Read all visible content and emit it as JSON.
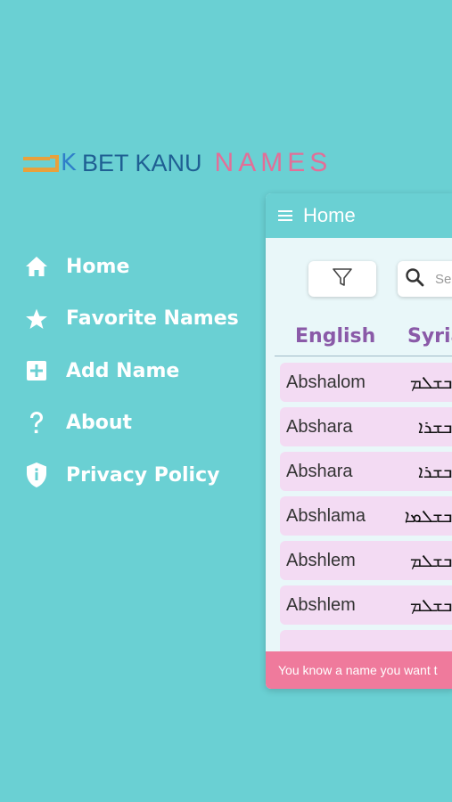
{
  "logo": {
    "text_primary": "BET KANU",
    "text_secondary": "NAMES",
    "mark_letter": "K"
  },
  "menu": {
    "items": [
      {
        "label": "Home",
        "icon": "home-icon"
      },
      {
        "label": "Favorite Names",
        "icon": "star-icon"
      },
      {
        "label": "Add Name",
        "icon": "add-box-icon"
      },
      {
        "label": "About",
        "icon": "question-icon"
      },
      {
        "label": "Privacy Policy",
        "icon": "shield-icon"
      }
    ]
  },
  "app": {
    "title": "Home",
    "search_placeholder": "Se",
    "columns": {
      "english": "English",
      "syriac": "Syria"
    },
    "rows": [
      {
        "english": "Abshalom",
        "syriac": "ܐܒܫܠܡ"
      },
      {
        "english": "Abshara",
        "syriac": "ܐܒܫܪܐ"
      },
      {
        "english": "Abshara",
        "syriac": "ܐܒܫܪܐ"
      },
      {
        "english": "Abshlama",
        "syriac": "ܐܒܫܠܡܐ"
      },
      {
        "english": "Abshlem",
        "syriac": "ܐܒܫܠܡ"
      },
      {
        "english": "Abshlem",
        "syriac": "ܐܒܫܠܡ"
      }
    ],
    "banner": "You know a name you want t"
  },
  "colors": {
    "background": "#6ad0d3",
    "accent_purple": "#8a5aa8",
    "row_pink": "#f3dbf3",
    "banner_pink": "#ef7a9c",
    "logo_blue": "#1f5f93",
    "logo_pink": "#e26f98",
    "logo_orange": "#e8a13c"
  }
}
